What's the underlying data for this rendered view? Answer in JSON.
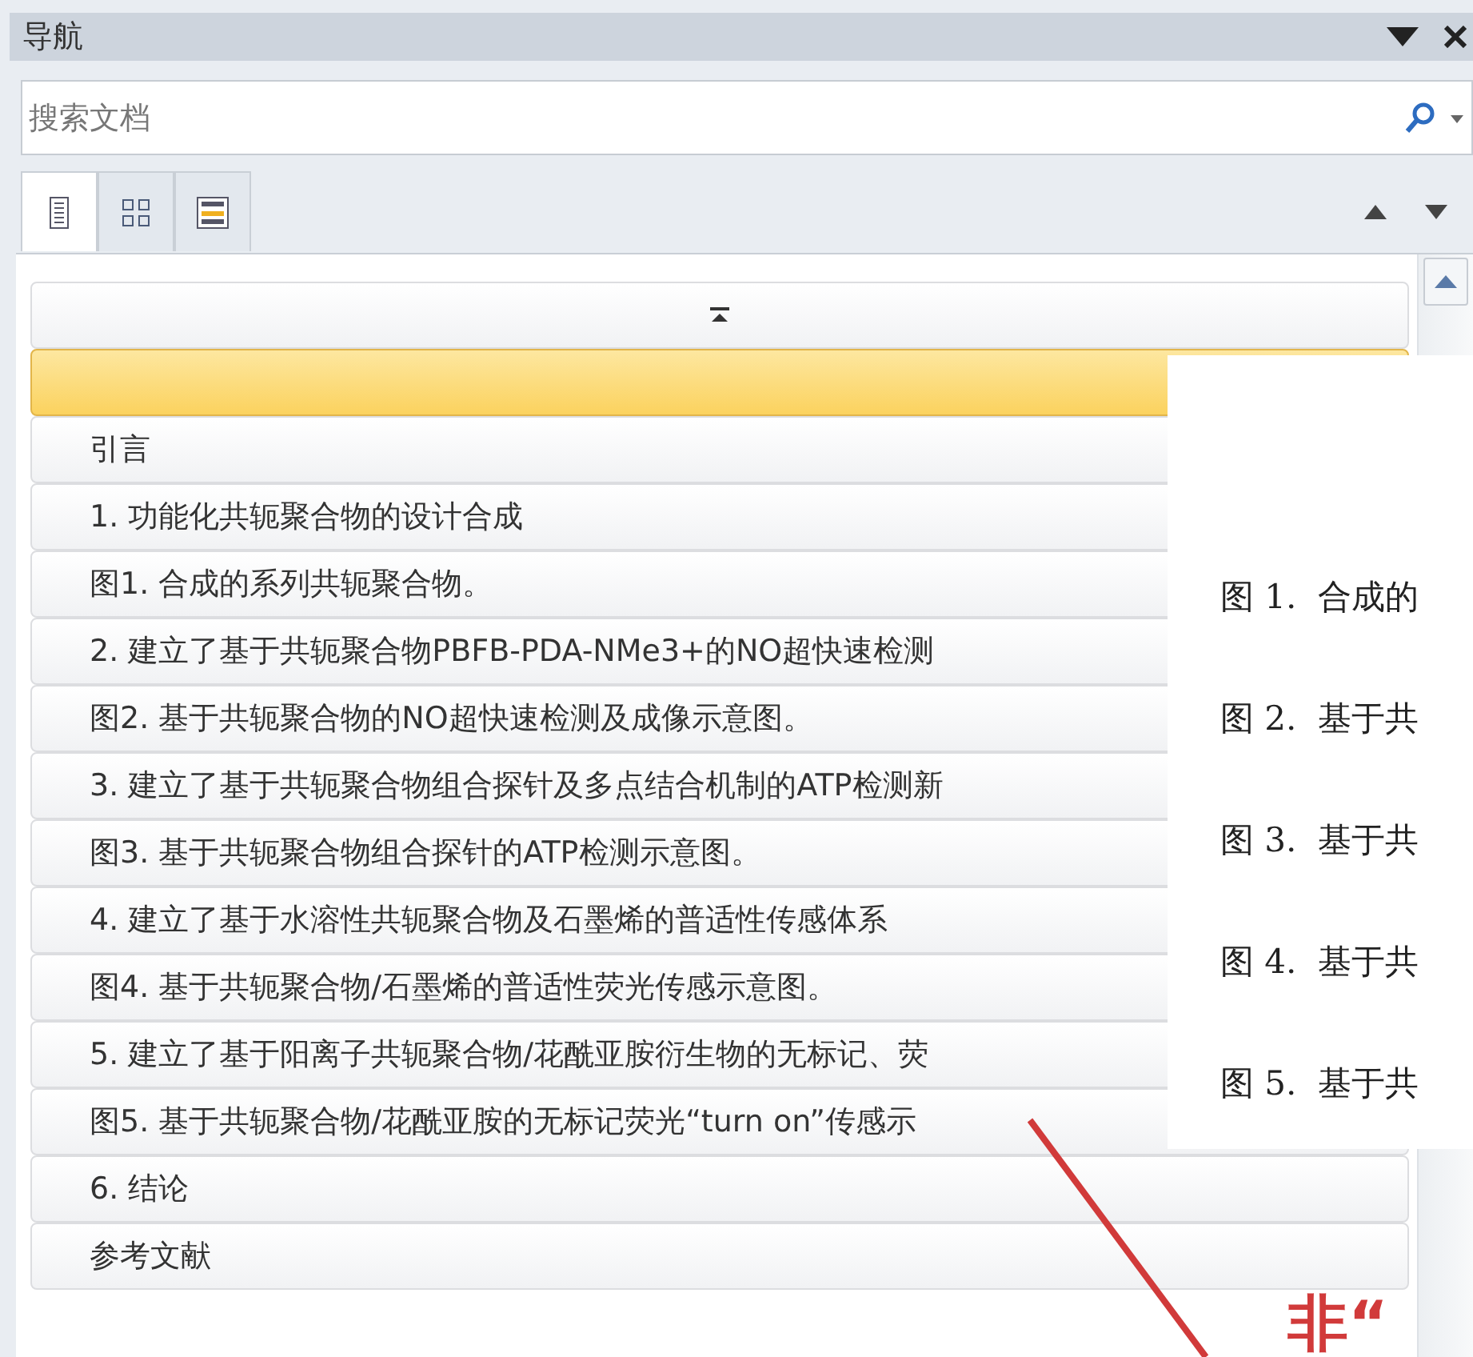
{
  "pane": {
    "title": "导航"
  },
  "search": {
    "placeholder": "搜索文档"
  },
  "tabs": [
    {
      "kind": "headings",
      "selected": true
    },
    {
      "kind": "pages",
      "selected": false
    },
    {
      "kind": "results",
      "selected": false
    }
  ],
  "headings": [
    {
      "selected": true
    },
    {
      "text": "引言",
      "selected": false
    },
    {
      "text": "1. 功能化共轭聚合物的设计合成",
      "selected": false
    },
    {
      "text": "图1. 合成的系列共轭聚合物。",
      "selected": false
    },
    {
      "text": "2. 建立了基于共轭聚合物PBFB-PDA-NMe3+的NO超快速检测",
      "selected": false
    },
    {
      "text": "图2. 基于共轭聚合物的NO超快速检测及成像示意图。",
      "selected": false
    },
    {
      "text": "3. 建立了基于共轭聚合物组合探针及多点结合机制的ATP检测新",
      "selected": false
    },
    {
      "text": "图3. 基于共轭聚合物组合探针的ATP检测示意图。",
      "selected": false
    },
    {
      "text": "4. 建立了基于水溶性共轭聚合物及石墨烯的普适性传感体系",
      "selected": false
    },
    {
      "text": "图4. 基于共轭聚合物/石墨烯的普适性荧光传感示意图。",
      "selected": false
    },
    {
      "text": "5. 建立了基于阳离子共轭聚合物/花酰亚胺衍生物的无标记、荧",
      "selected": false
    },
    {
      "text": "图5. 基于共轭聚合物/花酰亚胺的无标记荧光“turn on”传感示",
      "selected": false
    },
    {
      "text": "6. 结论",
      "selected": false
    },
    {
      "text": "参考文献",
      "selected": false
    }
  ],
  "popup": {
    "lines": [
      "图 1.  合成的",
      "图 2.  基于共",
      "图 3.  基于共",
      "图 4.  基于共",
      "图 5.  基于共"
    ]
  },
  "annotation": {
    "text": "非“"
  }
}
